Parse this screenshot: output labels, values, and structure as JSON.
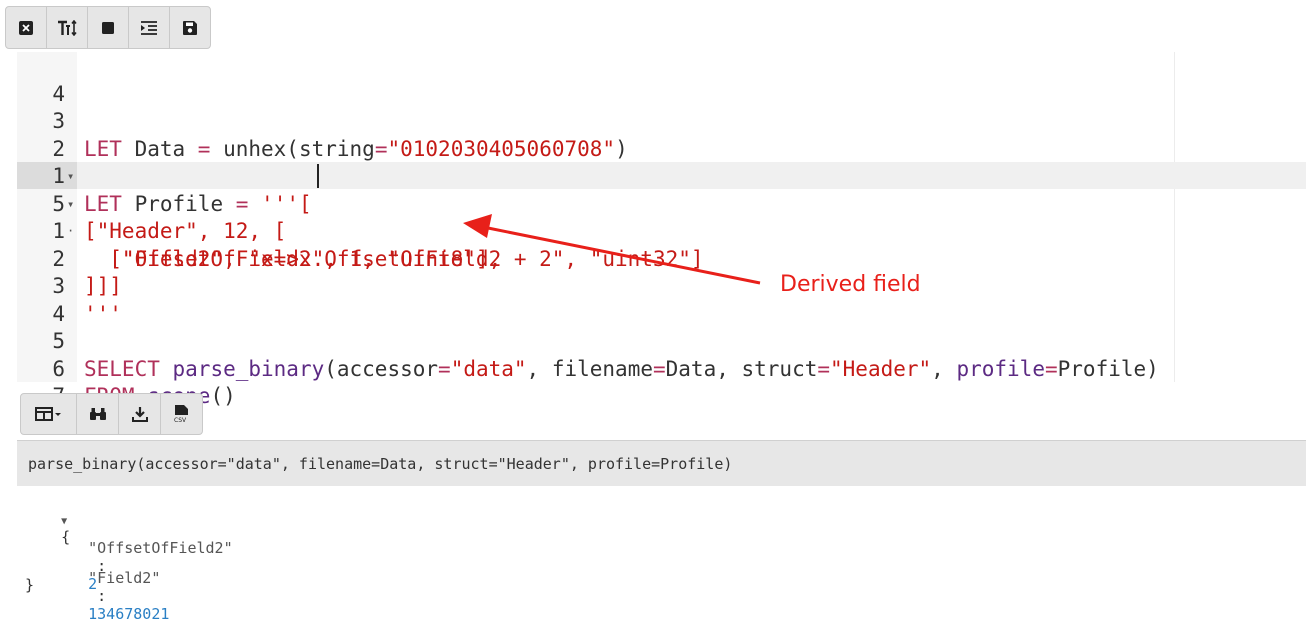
{
  "toolbar": {
    "buttons": [
      {
        "icon": "close-box-icon",
        "name": "clear-button"
      },
      {
        "icon": "text-size-icon",
        "name": "text-size-button"
      },
      {
        "icon": "stop-icon",
        "name": "stop-button"
      },
      {
        "icon": "indent-icon",
        "name": "indent-button"
      },
      {
        "icon": "save-icon",
        "name": "save-button"
      }
    ]
  },
  "editor": {
    "lines": [
      {
        "num": "4",
        "fold": "",
        "code": ""
      },
      {
        "num": "3",
        "fold": "",
        "code": "LET Data = unhex(string=\"0102030405060708\")"
      },
      {
        "num": "2",
        "fold": "▾",
        "code": "LET Profile = '''["
      },
      {
        "num": "1",
        "fold": "▾",
        "code": "[\"Header\", 12, ["
      },
      {
        "num": "5",
        "fold": "·",
        "code": "  [\"OffsetOfField2\", 1, \"uint8\"],"
      },
      {
        "num": "1",
        "fold": "",
        "code": "  [\"Field2\", \"x=>x.OffsetOfField2 + 2\", \"uint32\"]"
      },
      {
        "num": "2",
        "fold": "",
        "code": "]]]"
      },
      {
        "num": "3",
        "fold": "",
        "code": "'''"
      },
      {
        "num": "4",
        "fold": "",
        "code": ""
      },
      {
        "num": "5",
        "fold": "",
        "code": "SELECT parse_binary(accessor=\"data\", filename=Data, struct=\"Header\", profile=Profile)"
      },
      {
        "num": "6",
        "fold": "",
        "code": "FROM scope()"
      },
      {
        "num": "7",
        "fold": "",
        "code": ""
      }
    ]
  },
  "annotation": {
    "label": "Derived field",
    "color": "#e8201a"
  },
  "results_toolbar": {
    "buttons": [
      {
        "icon": "columns-dropdown-icon",
        "name": "columns-button"
      },
      {
        "icon": "binoculars-icon",
        "name": "search-button"
      },
      {
        "icon": "download-icon",
        "name": "download-button"
      },
      {
        "icon": "csv-file-icon",
        "name": "csv-export-button"
      }
    ]
  },
  "results": {
    "column_header": "parse_binary(accessor=\"data\", filename=Data, struct=\"Header\", profile=Profile)",
    "open_brace": "{",
    "close_brace": "}",
    "fields": [
      {
        "key": "\"OffsetOfField2\"",
        "value": "2"
      },
      {
        "key": "\"Field2\"",
        "value": "134678021"
      }
    ]
  }
}
